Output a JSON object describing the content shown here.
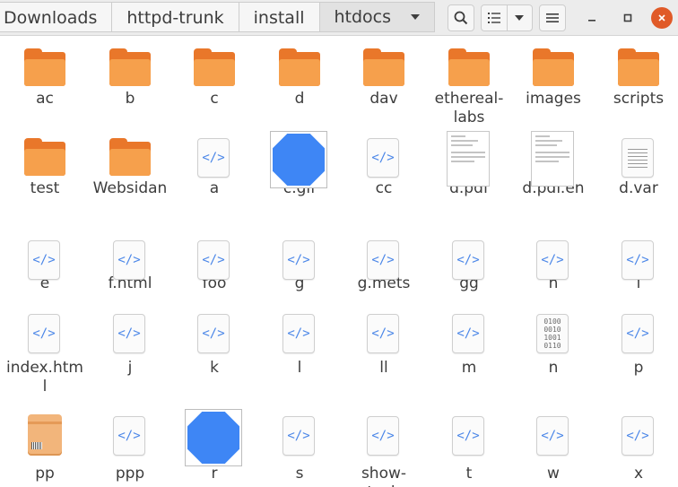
{
  "path_bar": {
    "crumbs": [
      "Downloads",
      "httpd-trunk",
      "install",
      "htdocs"
    ]
  },
  "header": {
    "search_icon": "search-icon",
    "view_icon": "list-view-icon",
    "view_dropdown_icon": "chevron-down-icon",
    "menu_icon": "hamburger-menu-icon",
    "minimize_icon": "minimize-icon",
    "maximize_icon": "maximize-icon",
    "close_icon": "close-icon",
    "close_color": "#e05a28"
  },
  "files": [
    {
      "name": "ac",
      "type": "folder"
    },
    {
      "name": "b",
      "type": "folder"
    },
    {
      "name": "c",
      "type": "folder"
    },
    {
      "name": "d",
      "type": "folder"
    },
    {
      "name": "dav",
      "type": "folder"
    },
    {
      "name": "ethereal-labs",
      "type": "folder"
    },
    {
      "name": "images",
      "type": "folder"
    },
    {
      "name": "scripts",
      "type": "folder"
    },
    {
      "name": "test",
      "type": "folder"
    },
    {
      "name": "Websidan",
      "type": "folder"
    },
    {
      "name": "a",
      "type": "code"
    },
    {
      "name": "c.gif",
      "type": "image"
    },
    {
      "name": "cc",
      "type": "code"
    },
    {
      "name": "d.pdf",
      "type": "pdf"
    },
    {
      "name": "d.pdf.en",
      "type": "pdf"
    },
    {
      "name": "d.var",
      "type": "text"
    },
    {
      "name": "e",
      "type": "code"
    },
    {
      "name": "f.html",
      "type": "code"
    },
    {
      "name": "foo",
      "type": "code"
    },
    {
      "name": "g",
      "type": "code"
    },
    {
      "name": "g.mets",
      "type": "code"
    },
    {
      "name": "gg",
      "type": "code"
    },
    {
      "name": "h",
      "type": "code"
    },
    {
      "name": "i",
      "type": "code"
    },
    {
      "name": "index.html",
      "type": "code"
    },
    {
      "name": "j",
      "type": "code"
    },
    {
      "name": "k",
      "type": "code"
    },
    {
      "name": "l",
      "type": "code"
    },
    {
      "name": "ll",
      "type": "code"
    },
    {
      "name": "m",
      "type": "code"
    },
    {
      "name": "n",
      "type": "binary"
    },
    {
      "name": "p",
      "type": "code"
    },
    {
      "name": "pp",
      "type": "package"
    },
    {
      "name": "ppp",
      "type": "code"
    },
    {
      "name": "r",
      "type": "image"
    },
    {
      "name": "s",
      "type": "code"
    },
    {
      "name": "show-tech",
      "type": "code"
    },
    {
      "name": "t",
      "type": "code"
    },
    {
      "name": "w",
      "type": "code"
    },
    {
      "name": "x",
      "type": "code"
    }
  ],
  "icon_glyphs": {
    "code": "</>",
    "binary": "0100\n0010\n1001\n0110"
  },
  "colors": {
    "folder_dark": "#e9772a",
    "folder_light": "#f6a04c",
    "code_glyph": "#4a86e8",
    "image_fill": "#3e86f5"
  }
}
